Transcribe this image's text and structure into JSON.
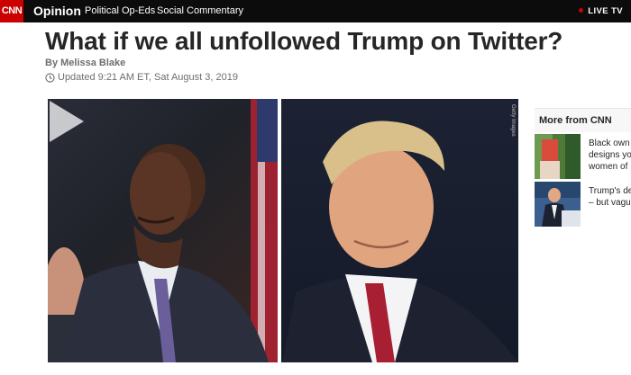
{
  "nav": {
    "logo": "CNN",
    "section": "Opinion",
    "links": [
      "Political Op-Eds",
      "Social Commentary"
    ],
    "live_tv": "LIVE TV"
  },
  "article": {
    "headline": "What if we all unfollowed Trump on Twitter?",
    "byline": "By Melissa Blake",
    "updated": "Updated 9:21 AM ET, Sat August 3, 2019"
  },
  "video": {
    "credit": "Getty Images"
  },
  "rail": {
    "title": "More from CNN",
    "items": [
      {
        "lines": [
          "Black own",
          "designs yo",
          "women of"
        ]
      },
      {
        "lines": [
          "Trump's de",
          "– but vagu"
        ]
      }
    ]
  },
  "colors": {
    "brand_red": "#cc0000",
    "nav_bg": "#0c0c0c"
  }
}
